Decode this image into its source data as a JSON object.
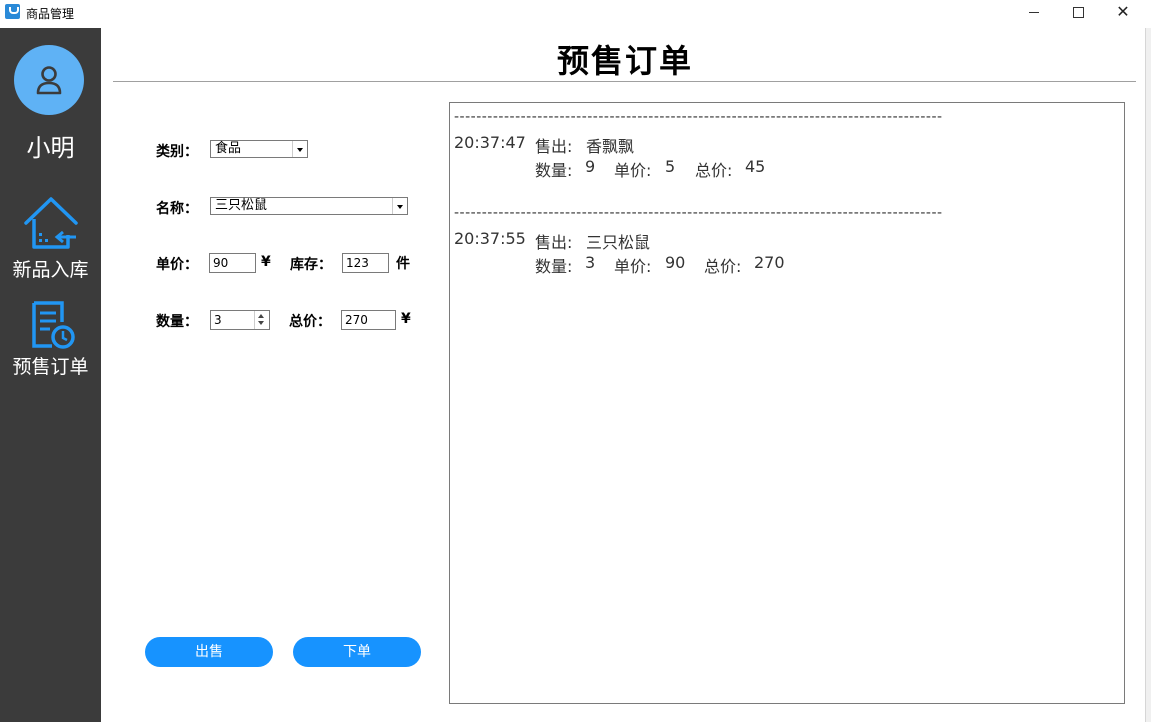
{
  "window": {
    "title": "商品管理"
  },
  "sidebar": {
    "username": "小明",
    "items": [
      {
        "label": "新品入库",
        "icon": "house-import-icon"
      },
      {
        "label": "预售订单",
        "icon": "order-clock-icon"
      }
    ]
  },
  "page": {
    "title": "预售订单"
  },
  "form": {
    "category": {
      "label": "类别：",
      "value": "食品"
    },
    "name": {
      "label": "名称：",
      "value": "三只松鼠"
    },
    "unit_price": {
      "label": "单价：",
      "value": "90",
      "currency": "¥"
    },
    "stock": {
      "label": "库存：",
      "value": "123",
      "unit": "件"
    },
    "quantity": {
      "label": "数量：",
      "value": "3"
    },
    "total_price": {
      "label": "总价：",
      "value": "270",
      "currency": "¥"
    },
    "sell_button": "出售",
    "order_button": "下单"
  },
  "log": {
    "separator": "----------------------------------------------------------------------------------------",
    "entries": [
      {
        "time": "20:37:47",
        "sold_label": "售出:",
        "product": "香飘飘",
        "qty_label": "数量:",
        "qty": "9",
        "price_label": "单价:",
        "price": "5",
        "total_label": "总价:",
        "total": "45"
      },
      {
        "time": "20:37:55",
        "sold_label": "售出:",
        "product": "三只松鼠",
        "qty_label": "数量:",
        "qty": "3",
        "price_label": "单价:",
        "price": "90",
        "total_label": "总价:",
        "total": "270"
      }
    ]
  },
  "colors": {
    "sidebar_bg": "#3b3b3b",
    "accent": "#1793ff",
    "avatar": "#5fb2f5"
  }
}
